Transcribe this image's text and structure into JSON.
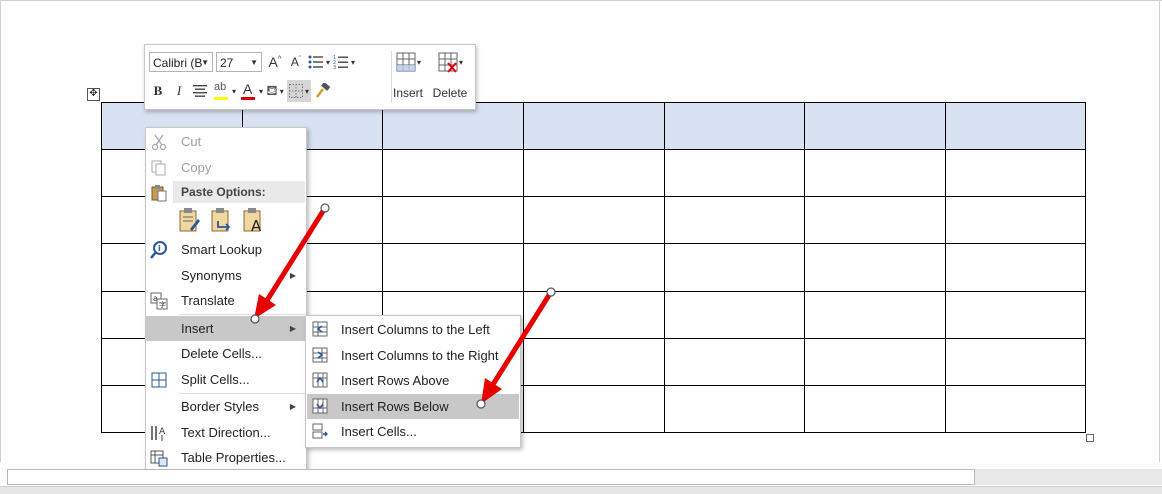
{
  "toolbar": {
    "font_name": "Calibri (B",
    "font_size": "27",
    "insert_label": "Insert",
    "delete_label": "Delete"
  },
  "context_menu": {
    "cut": "Cut",
    "copy": "Copy",
    "paste_options": "Paste Options:",
    "smart_lookup": "Smart Lookup",
    "synonyms": "Synonyms",
    "translate": "Translate",
    "insert": "Insert",
    "delete_cells": "Delete Cells...",
    "split_cells": "Split Cells...",
    "border_styles": "Border Styles",
    "text_direction": "Text Direction...",
    "table_properties": "Table Properties..."
  },
  "submenu": {
    "insert_columns_left": "Insert Columns to the Left",
    "insert_columns_right": "Insert Columns to the Right",
    "insert_rows_above": "Insert Rows Above",
    "insert_rows_below": "Insert Rows Below",
    "insert_cells": "Insert Cells..."
  },
  "colors": {
    "header_fill": "#d9e2f3",
    "highlight": "#ffff00",
    "font_color": "#e00000",
    "annotation_arrow": "#e60000"
  }
}
